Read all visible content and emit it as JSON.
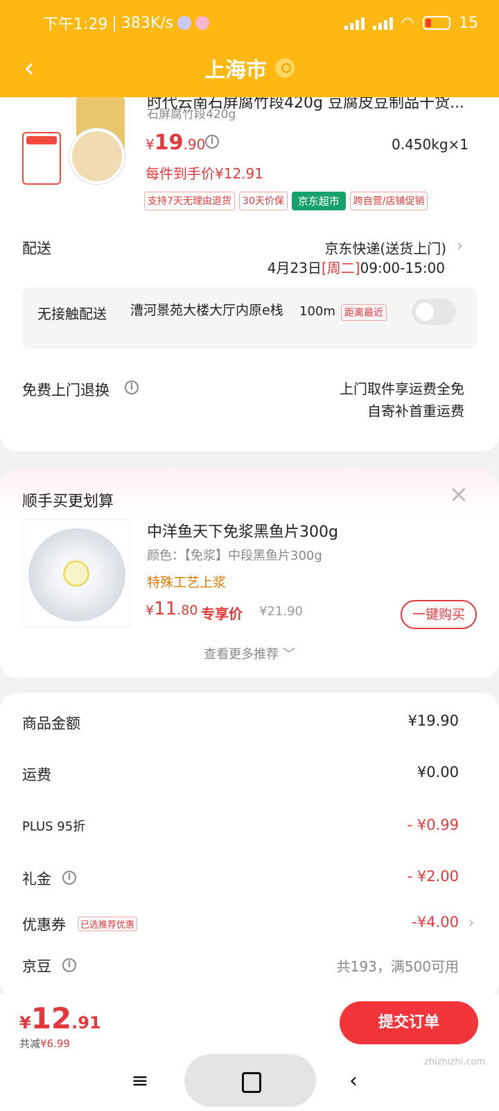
{
  "status_bar": {
    "time": "下午1:29",
    "net_speed": "383K/s",
    "battery": "15"
  },
  "header": {
    "back": "‹",
    "city": "上海市",
    "location_icon": "location-pin-icon"
  },
  "product": {
    "title": "时代云南石屏腐竹段420g 豆腐皮豆制品干货...",
    "spec": "石屏腐竹段420g",
    "price_cur": "¥",
    "price_int": "19",
    "price_dec": ".90",
    "weight": "0.450kg×1",
    "final_price": "每件到手价¥12.91",
    "tags": [
      "支持7天无理由退货",
      "30天价保",
      "京东超市",
      "跨自营/店铺促销"
    ]
  },
  "delivery": {
    "label": "配送",
    "method": "京东快递(送货上门)",
    "date": "4月23日",
    "weekday": "[周二]",
    "time": "09:00-15:00"
  },
  "no_contact": {
    "label": "无接触配送",
    "address": "漕河景苑大楼大厅内原e栈",
    "distance": "100m",
    "nearest": "距离最近"
  },
  "free_return": {
    "label": "免费上门退换",
    "line1": "上门取件享运费全免",
    "line2": "自寄补首重运费"
  },
  "recommend": {
    "title": "顺手买更划算",
    "name": "中洋鱼天下免浆黑鱼片300g",
    "spec": "颜色：【免浆】中段黑鱼片300g",
    "feature": "特殊工艺上浆",
    "price_cur": "¥",
    "price_int": "11",
    "price_dec": ".80",
    "plus_label": "专享价",
    "orig_price": "¥21.90",
    "buy_label": "一键购买",
    "more_label": "查看更多推荐 ﹀"
  },
  "summary": {
    "goods_label": "商品金额",
    "goods_val": "¥19.90",
    "ship_label": "运费",
    "ship_val": "¥0.00",
    "plus_label": "PLUS 95折",
    "plus_val": "- ¥0.99",
    "gift_label": "礼金",
    "gift_val": "- ¥2.00",
    "coupon_label": "优惠券",
    "coupon_tag": "已选推荐优惠",
    "coupon_val": "-¥4.00",
    "jd_label": "京豆",
    "jd_val": "共193，满500可用"
  },
  "bottom": {
    "total_cur": "¥",
    "total_int": "12",
    "total_dec": ".91",
    "saved_label": "共减",
    "saved_val": "¥6.99",
    "submit_label": "提交订单"
  },
  "watermark": "zhizhizhi.com",
  "colors": {
    "brand_yellow": "#fdb813",
    "accent_red": "#e4393c",
    "jd_green": "#16a36b"
  }
}
